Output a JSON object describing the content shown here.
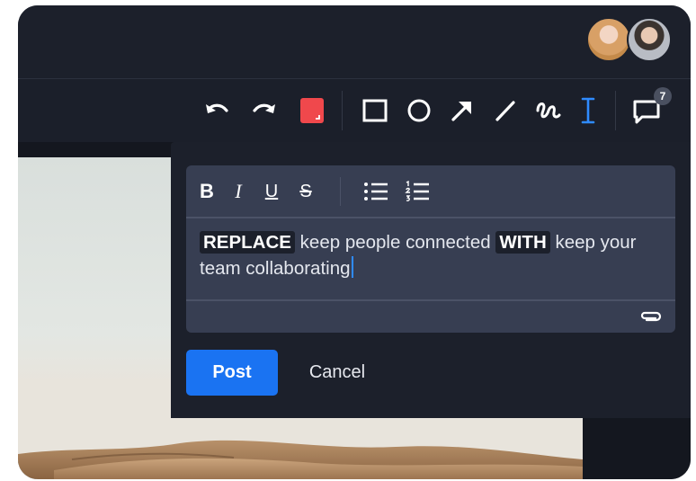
{
  "comments": {
    "count": "7"
  },
  "editor": {
    "format": {
      "bold": "B",
      "italic": "I",
      "underline": "U",
      "strike": "S"
    },
    "content": {
      "tag_replace": "REPLACE",
      "text_1": " keep people connected ",
      "tag_with": "WITH",
      "text_2": " keep your team collaborating"
    }
  },
  "actions": {
    "post_label": "Post",
    "cancel_label": "Cancel"
  },
  "icons": {
    "undo": "undo-icon",
    "redo": "redo-icon",
    "color": "color-swatch-icon",
    "rectangle": "rectangle-icon",
    "circle": "circle-icon",
    "arrow": "arrow-icon",
    "line": "line-icon",
    "freehand": "freehand-icon",
    "text": "text-cursor-icon",
    "comments": "comment-icon",
    "attach": "paperclip-icon"
  },
  "colors": {
    "accent": "#1a73f2",
    "swatch": "#f0484c",
    "text_tool_active": "#2f8bff"
  }
}
